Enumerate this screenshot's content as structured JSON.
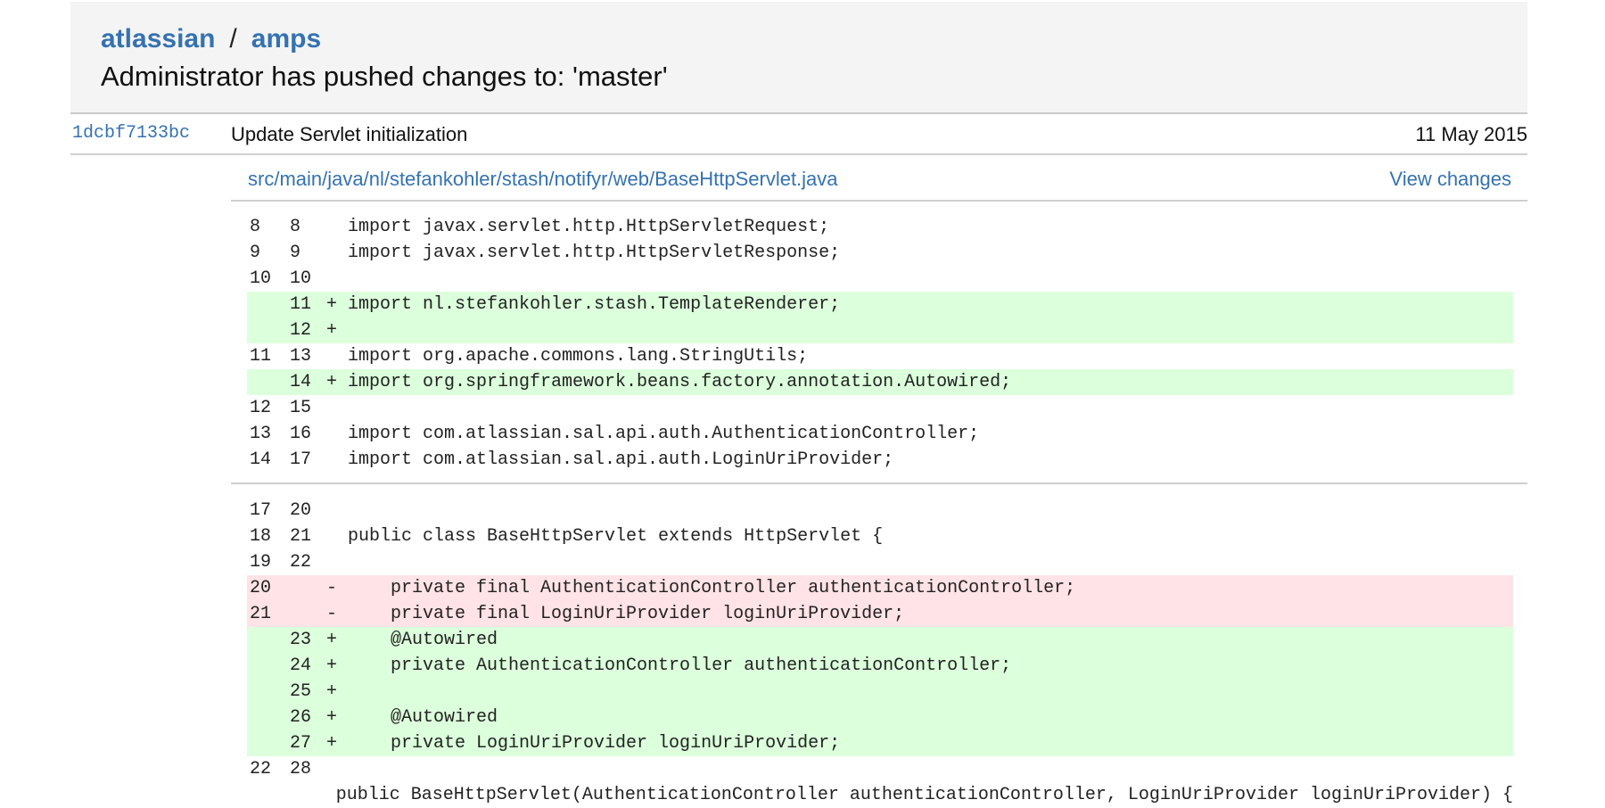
{
  "breadcrumb": {
    "project": "atlassian",
    "separator": "/",
    "repo": "amps"
  },
  "headline": "Administrator has pushed changes to: 'master'",
  "commit": {
    "hash": "1dcbf7133bc",
    "message": "Update Servlet initialization",
    "date": "11 May 2015"
  },
  "file": {
    "path": "src/main/java/nl/stefankohler/stash/notifyr/web/BaseHttpServlet.java",
    "view_changes": "View changes"
  },
  "colors": {
    "link": "#3572b0",
    "added_bg": "#dcffdc",
    "removed_bg": "#ffe3e6"
  },
  "hunks": [
    {
      "lines": [
        {
          "old": "8",
          "new": "8",
          "marker": "",
          "code": "import javax.servlet.http.HttpServletRequest;"
        },
        {
          "old": "9",
          "new": "9",
          "marker": "",
          "code": "import javax.servlet.http.HttpServletResponse;"
        },
        {
          "old": "10",
          "new": "10",
          "marker": "",
          "code": ""
        },
        {
          "old": "",
          "new": "11",
          "marker": "+",
          "code": "import nl.stefankohler.stash.TemplateRenderer;"
        },
        {
          "old": "",
          "new": "12",
          "marker": "+",
          "code": ""
        },
        {
          "old": "11",
          "new": "13",
          "marker": "",
          "code": "import org.apache.commons.lang.StringUtils;"
        },
        {
          "old": "",
          "new": "14",
          "marker": "+",
          "code": "import org.springframework.beans.factory.annotation.Autowired;"
        },
        {
          "old": "12",
          "new": "15",
          "marker": "",
          "code": ""
        },
        {
          "old": "13",
          "new": "16",
          "marker": "",
          "code": "import com.atlassian.sal.api.auth.AuthenticationController;"
        },
        {
          "old": "14",
          "new": "17",
          "marker": "",
          "code": "import com.atlassian.sal.api.auth.LoginUriProvider;"
        }
      ]
    },
    {
      "lines": [
        {
          "old": "17",
          "new": "20",
          "marker": "",
          "code": ""
        },
        {
          "old": "18",
          "new": "21",
          "marker": "",
          "code": "public class BaseHttpServlet extends HttpServlet {"
        },
        {
          "old": "19",
          "new": "22",
          "marker": "",
          "code": ""
        },
        {
          "old": "20",
          "new": "",
          "marker": "-",
          "code": "    private final AuthenticationController authenticationController;"
        },
        {
          "old": "21",
          "new": "",
          "marker": "-",
          "code": "    private final LoginUriProvider loginUriProvider;"
        },
        {
          "old": "",
          "new": "23",
          "marker": "+",
          "code": "    @Autowired"
        },
        {
          "old": "",
          "new": "24",
          "marker": "+",
          "code": "    private AuthenticationController authenticationController;"
        },
        {
          "old": "",
          "new": "25",
          "marker": "+",
          "code": ""
        },
        {
          "old": "",
          "new": "26",
          "marker": "+",
          "code": "    @Autowired"
        },
        {
          "old": "",
          "new": "27",
          "marker": "+",
          "code": "    private LoginUriProvider loginUriProvider;"
        },
        {
          "old": "22",
          "new": "28",
          "marker": "",
          "code": ""
        },
        {
          "old": "",
          "new": "",
          "marker": "",
          "code": "    public BaseHttpServlet(AuthenticationController authenticationController, LoginUriProvider loginUriProvider) {"
        }
      ]
    }
  ]
}
